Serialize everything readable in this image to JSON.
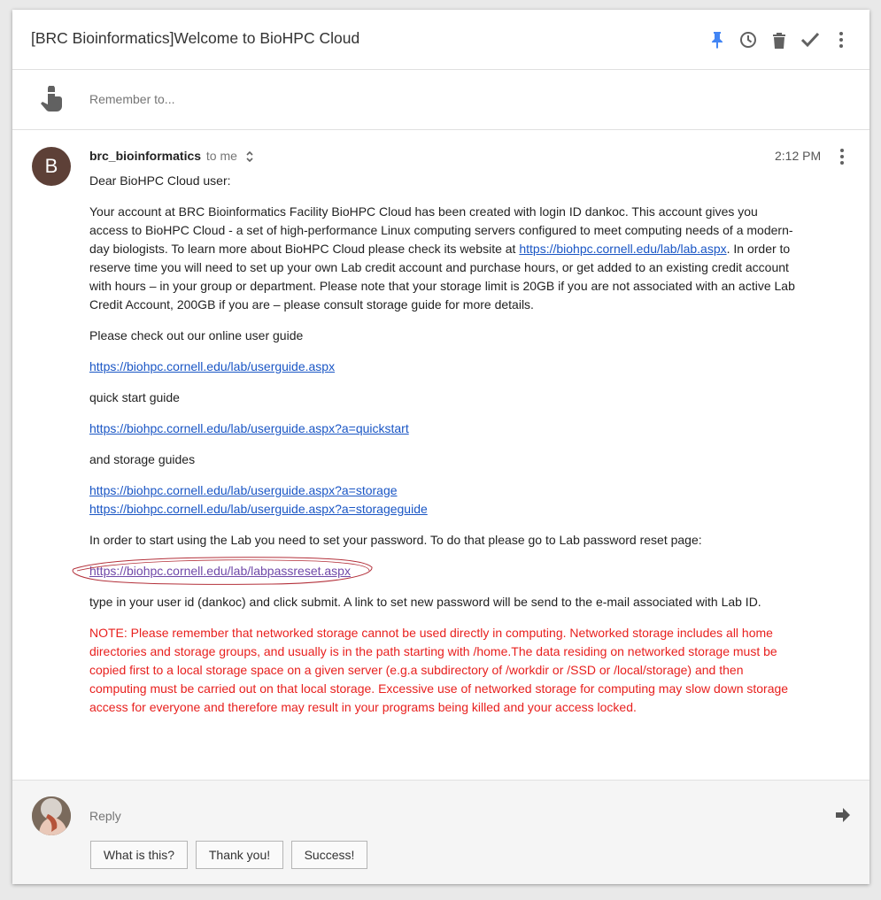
{
  "header": {
    "subject": "[BRC Bioinformatics]Welcome to BioHPC Cloud",
    "icons": [
      "pin-icon",
      "snooze-icon",
      "trash-icon",
      "done-icon",
      "more-icon"
    ],
    "accent_color": "#4285f4"
  },
  "reminder": {
    "placeholder": "Remember to..."
  },
  "message": {
    "avatar_letter": "B",
    "avatar_color": "#5d4037",
    "sender": "brc_bioinformatics",
    "recipient": "to me",
    "time": "2:12 PM",
    "greeting": "Dear BioHPC Cloud user:",
    "para1_a": "Your account at BRC Bioinformatics Facility BioHPC Cloud has been created with login ID dankoc. This account gives you access to BioHPC Cloud - a set of high-performance Linux computing servers configured to meet computing needs of a modern-day biologists. To learn more about BioHPC Cloud please check its website at ",
    "para1_link": "https://biohpc.cornell.edu/lab/lab.aspx",
    "para1_b": ". In order to reserve time you will need to set up your own Lab credit account and purchase hours, or get added to an existing credit account with hours – in your group or department. Please note that your storage limit is 20GB if you are not associated with an active Lab Credit Account, 200GB if you are – please consult storage guide for more details.",
    "user_guide_intro": "Please check out our online user guide",
    "user_guide_link": "https://biohpc.cornell.edu/lab/userguide.aspx",
    "quickstart_intro": "quick start guide",
    "quickstart_link": "https://biohpc.cornell.edu/lab/userguide.aspx?a=quickstart",
    "storage_intro": "and storage guides",
    "storage_link1": "https://biohpc.cornell.edu/lab/userguide.aspx?a=storage",
    "storage_link2": "https://biohpc.cornell.edu/lab/userguide.aspx?a=storageguide",
    "password_intro": "In order to start using the Lab you need to set your password. To do that please go to Lab password reset page:",
    "password_link": "https://biohpc.cornell.edu/lab/labpassreset.aspx",
    "password_outro": "type in your user id (dankoc) and click submit. A link to set new password will be send to the e-mail associated with Lab ID.",
    "note": "NOTE: Please remember that networked storage cannot be used directly in computing. Networked storage includes all home directories and storage groups, and usually is in the path starting with /home.The data residing on networked storage must be copied first to a local storage space on a given server (e.g.a subdirectory of /workdir or /SSD or /local/storage) and then computing must be carried out on that local storage. Excessive use of networked storage for computing may slow down storage access for everyone and therefore may result in your programs being killed and your access locked.",
    "note_color": "#e8201e",
    "link_color": "#1a56c5",
    "visited_link_color": "#7048a8"
  },
  "reply": {
    "placeholder": "Reply",
    "smart_replies": [
      "What is this?",
      "Thank you!",
      "Success!"
    ]
  }
}
